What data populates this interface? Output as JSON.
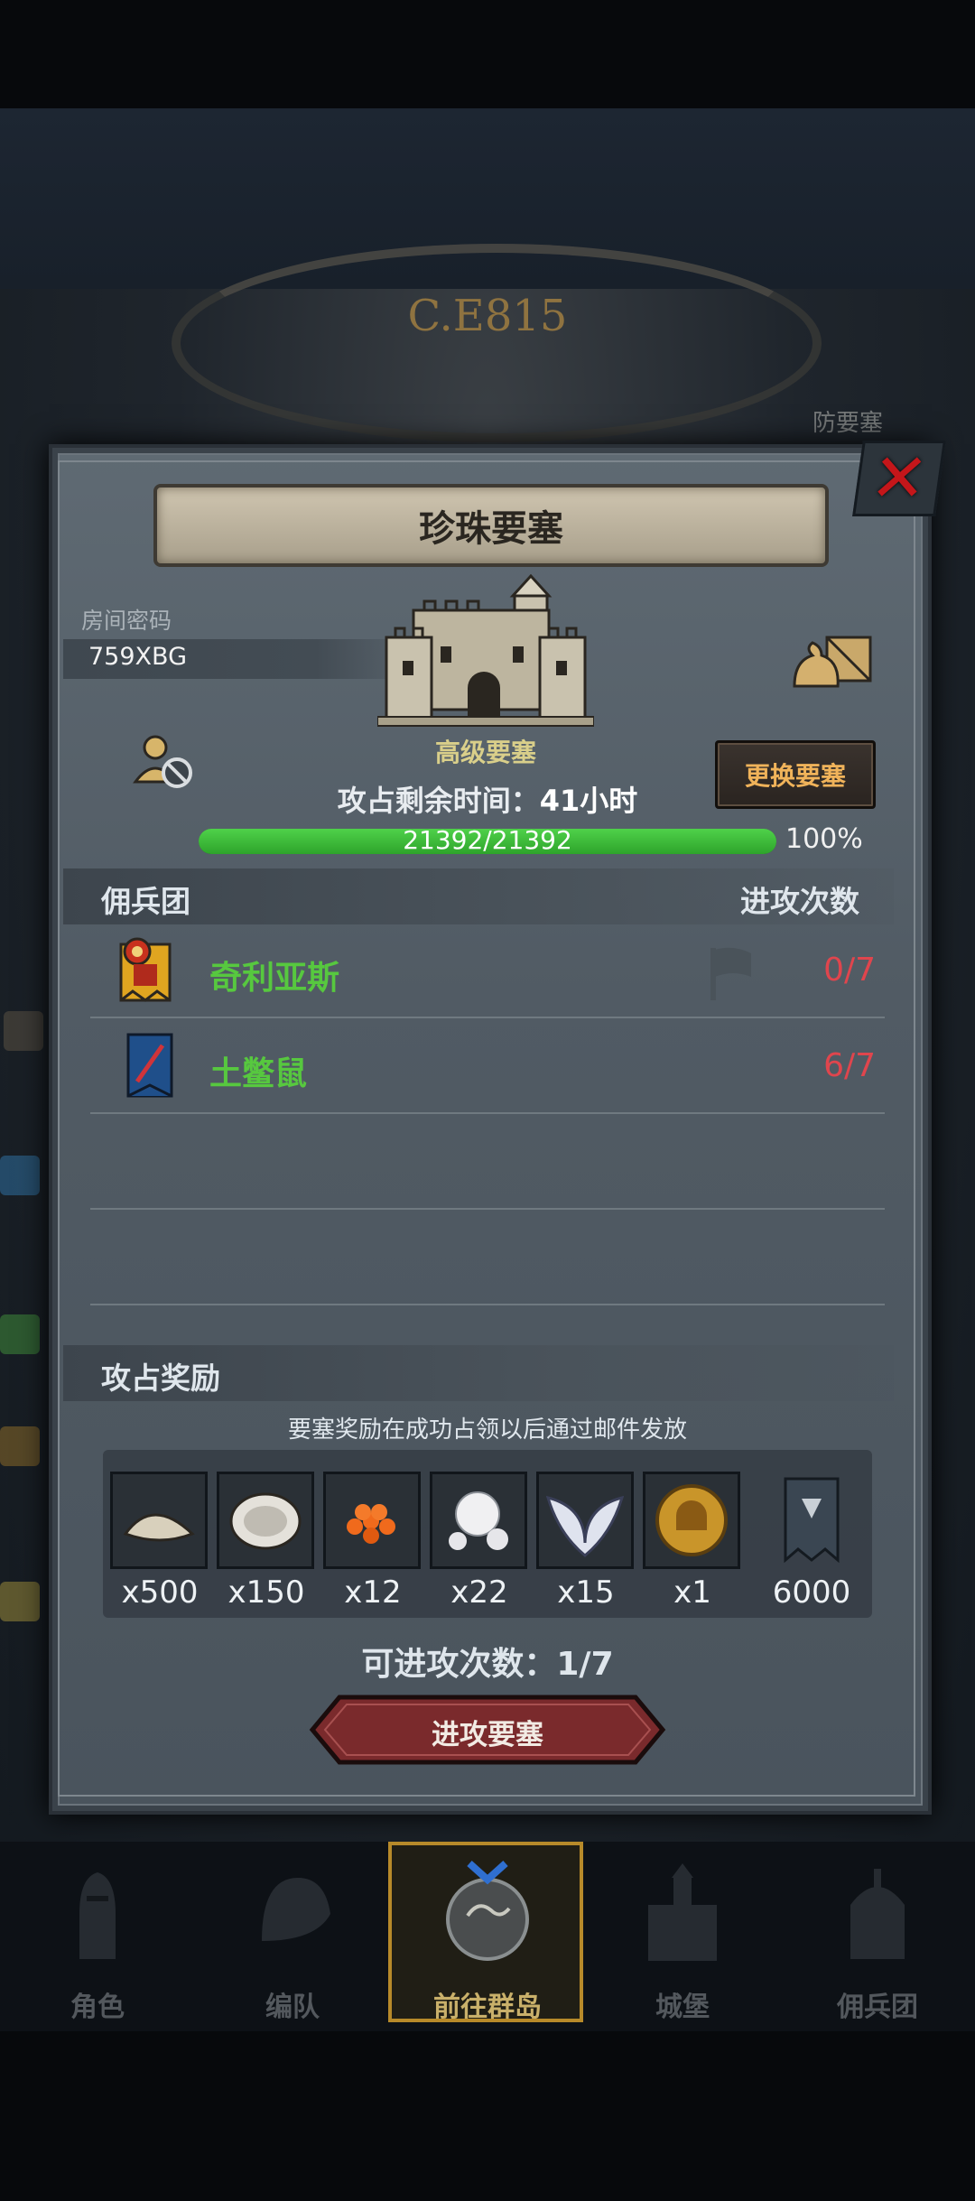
{
  "background": {
    "era_label": "C.E815",
    "right_label": "防要塞"
  },
  "dialog": {
    "title": "珍珠要塞",
    "room_code_label": "房间密码",
    "room_code": "759XBG",
    "fortress_level": "高级要塞",
    "change_button": "更换要塞",
    "time_left_label": "攻占剩余时间：",
    "time_left_value": "41小时",
    "hp_text": "21392/21392",
    "hp_percent": "100%",
    "hp_fraction": 1.0
  },
  "mercenary_section": {
    "title": "佣兵团",
    "attack_count_header": "进攻次数",
    "rows": [
      {
        "name": "奇利亚斯",
        "count": "0/7",
        "icon": "banner-red-yellow-icon"
      },
      {
        "name": "土鳖鼠",
        "count": "6/7",
        "icon": "banner-blue-icon"
      }
    ]
  },
  "reward_section": {
    "title": "攻占奖励",
    "note": "要塞奖励在成功占领以后通过邮件发放",
    "items": [
      {
        "icon": "shell-powder-icon",
        "qty": "x500"
      },
      {
        "icon": "oyster-icon",
        "qty": "x150"
      },
      {
        "icon": "fish-roe-icon",
        "qty": "x12"
      },
      {
        "icon": "pearl-icon",
        "qty": "x22"
      },
      {
        "icon": "wing-emblem-icon",
        "qty": "x15"
      },
      {
        "icon": "knight-helmet-coin-icon",
        "qty": "x1"
      },
      {
        "icon": "guild-banner-icon",
        "qty": "6000"
      }
    ]
  },
  "attack": {
    "available_label": "可进攻次数：1/7",
    "button": "进攻要塞"
  },
  "nav": {
    "items": [
      {
        "label": "角色"
      },
      {
        "label": "编队"
      },
      {
        "label": "前往群岛"
      },
      {
        "label": "城堡"
      },
      {
        "label": "佣兵团"
      }
    ],
    "active_index": 2
  },
  "colors": {
    "close_red": "#c4161a",
    "hp_green": "#3fc13a",
    "merc_name_green": "#57c83f",
    "count_red": "#e0454d",
    "button_orange_text": "#f0b35a",
    "attack_button": "#7a2a2c"
  }
}
